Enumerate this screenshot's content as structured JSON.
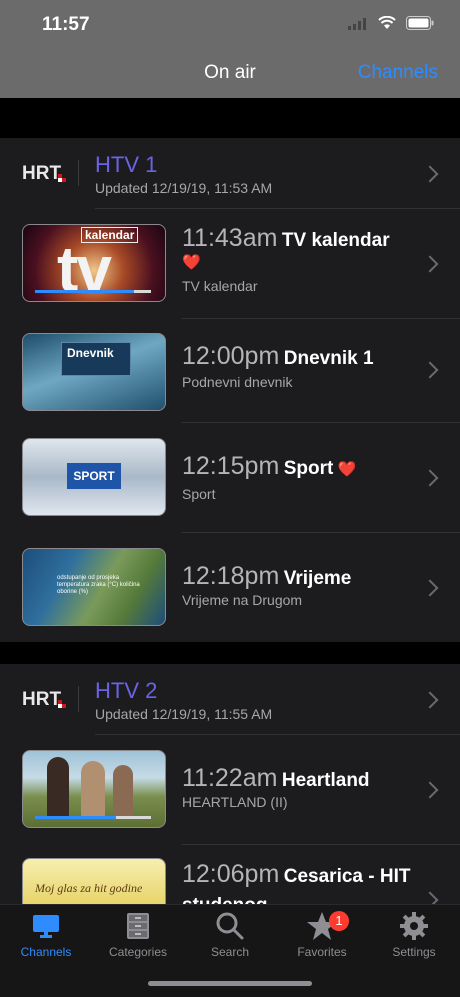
{
  "status": {
    "time": "11:57"
  },
  "nav": {
    "title": "On air",
    "right_button": "Channels"
  },
  "channels": [
    {
      "logo_text": "HRT",
      "name": "HTV 1",
      "updated": "Updated 12/19/19, 11:53 AM",
      "programs": [
        {
          "time": "11:43am",
          "title": "TV kalendar",
          "subtitle": "TV kalendar",
          "favorite": true,
          "thumb_label": "kalendar",
          "progress": 0.85
        },
        {
          "time": "12:00pm",
          "title": "Dnevnik 1",
          "subtitle": "Podnevni dnevnik",
          "favorite": false,
          "thumb_label": "Dnevnik"
        },
        {
          "time": "12:15pm",
          "title": "Sport",
          "subtitle": "Sport",
          "favorite": true,
          "thumb_label": "SPORT"
        },
        {
          "time": "12:18pm",
          "title": "Vrijeme",
          "subtitle": "Vrijeme na Drugom",
          "favorite": false,
          "thumb_label": "odstupanje od prosjeka temperatura zraka (°C) količina oborine (%)"
        }
      ]
    },
    {
      "logo_text": "HRT",
      "name": "HTV 2",
      "updated": "Updated 12/19/19, 11:55 AM",
      "programs": [
        {
          "time": "11:22am",
          "title": "Heartland",
          "subtitle": "HEARTLAND (II)",
          "favorite": false,
          "progress": 0.7
        },
        {
          "time": "12:06pm",
          "title": "Cesarica - HIT studenog",
          "subtitle": "",
          "favorite": false,
          "thumb_label": "Moj glas za hit godine"
        }
      ]
    }
  ],
  "tabs": [
    {
      "label": "Channels",
      "icon": "tv-icon",
      "active": true
    },
    {
      "label": "Categories",
      "icon": "cabinet-icon",
      "active": false
    },
    {
      "label": "Search",
      "icon": "search-icon",
      "active": false
    },
    {
      "label": "Favorites",
      "icon": "star-icon",
      "active": false,
      "badge": "1"
    },
    {
      "label": "Settings",
      "icon": "gear-icon",
      "active": false
    }
  ],
  "colors": {
    "accent": "#2e8cff",
    "channel_name": "#6a63e6",
    "heart": "#e0222d",
    "badge": "#ff3b30"
  }
}
